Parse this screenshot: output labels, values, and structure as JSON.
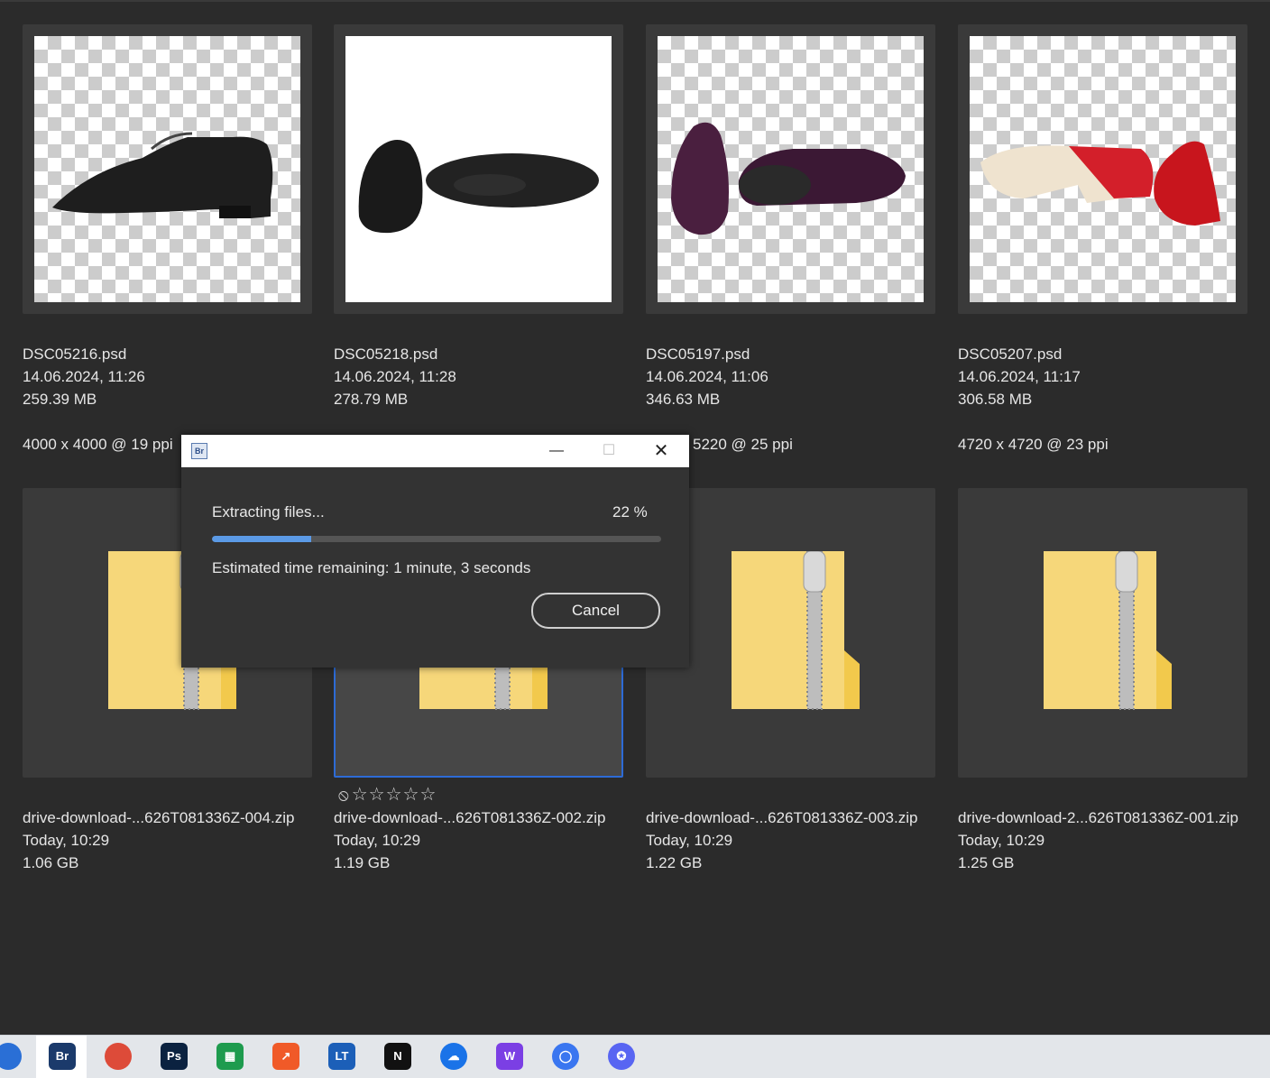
{
  "files_row1": [
    {
      "name": "DSC05216.psd",
      "date": "14.06.2024, 11:26",
      "size": "259.39 MB",
      "dimensions": "4000 x 4000 @ 19 ppi",
      "preview": "black-leather-shoe"
    },
    {
      "name": "DSC05218.psd",
      "date": "14.06.2024, 11:28",
      "size": "278.79 MB",
      "dimensions": "",
      "preview": "black-shoe-pair"
    },
    {
      "name": "DSC05197.psd",
      "date": "14.06.2024, 11:06",
      "size": "346.63 MB",
      "dimensions": "5220 @ 25 ppi",
      "preview": "purple-velvet-shoe-pair"
    },
    {
      "name": "DSC05207.psd",
      "date": "14.06.2024, 11:17",
      "size": "306.58 MB",
      "dimensions": "4720 x 4720 @ 23 ppi",
      "preview": "red-shoe-pair"
    }
  ],
  "files_row2": [
    {
      "name": "drive-download-...626T081336Z-004.zip",
      "date": "Today, 10:29",
      "size": "1.06 GB",
      "icon": "zip-folder-icon"
    },
    {
      "name": "drive-download-...626T081336Z-002.zip",
      "date": "Today, 10:29",
      "size": "1.19 GB",
      "icon": "zip-folder-icon"
    },
    {
      "name": "drive-download-...626T081336Z-003.zip",
      "date": "Today, 10:29",
      "size": "1.22 GB",
      "icon": "zip-folder-icon"
    },
    {
      "name": "drive-download-2...626T081336Z-001.zip",
      "date": "Today, 10:29",
      "size": "1.25 GB",
      "icon": "zip-folder-icon"
    }
  ],
  "rating": {
    "reject_icon": "⦸",
    "stars": "☆☆☆☆☆"
  },
  "dialog": {
    "app_icon_label": "Br",
    "status": "Extracting files...",
    "percent_label": "22 %",
    "progress_fraction": 0.22,
    "eta": "Estimated time remaining: 1 minute, 3 seconds",
    "cancel_label": "Cancel",
    "min_glyph": "—",
    "max_glyph": "☐",
    "close_glyph": "✕"
  },
  "taskbar": {
    "icons": [
      {
        "name": "firefox-icon",
        "label": "",
        "color": "#2a6fd6"
      },
      {
        "name": "bridge-icon",
        "label": "Br",
        "color": "#1b3a6b"
      },
      {
        "name": "chrome-icon",
        "label": "",
        "color": "#dd4b39"
      },
      {
        "name": "photoshop-icon",
        "label": "Ps",
        "color": "#0b2240"
      },
      {
        "name": "sheets-icon",
        "label": "▦",
        "color": "#1e9b4e"
      },
      {
        "name": "analytics-icon",
        "label": "↗",
        "color": "#f05a28"
      },
      {
        "name": "languagetool-icon",
        "label": "LT",
        "color": "#1c5fb8"
      },
      {
        "name": "notion-icon",
        "label": "N",
        "color": "#111111"
      },
      {
        "name": "onedrive-icon",
        "label": "☁",
        "color": "#1a73e8"
      },
      {
        "name": "w-app-icon",
        "label": "W",
        "color": "#7b3fe4"
      },
      {
        "name": "signal-icon",
        "label": "◯",
        "color": "#3a76f0"
      },
      {
        "name": "discord-icon",
        "label": "✪",
        "color": "#5865f2"
      }
    ]
  }
}
